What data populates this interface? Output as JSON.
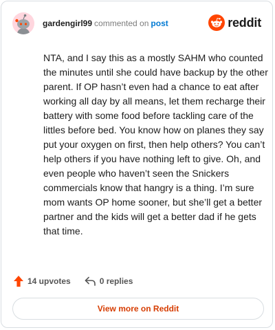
{
  "colors": {
    "accent_orange": "#ff4500",
    "link_blue": "#0079d3",
    "view_more_text": "#d63c00",
    "avatar_bg": "#ffd6de"
  },
  "header": {
    "avatar_icon": "reddit-snoo-avatar",
    "username": "gardengirl99",
    "action_text": "commented on",
    "post_link": "post",
    "brand_icon": "reddit-logo",
    "brand_name": "reddit"
  },
  "comment": {
    "text": "NTA, and I say this as a mostly SAHM who counted the minutes until she could have backup by the other parent. If OP hasn’t even had a chance to eat after working all day by all means, let them recharge their battery with some food before tackling care of the littles before bed. You know how on planes they say put your oxygen on first, then help others? You can’t help others if you have nothing left to give. Oh, and even people who haven’t seen the Snickers commercials know that hangry is a thing. I’m sure mom wants OP home sooner, but she’ll get a better partner and the kids will get a better dad if he gets that time."
  },
  "actions": {
    "upvotes_label": "14 upvotes",
    "upvote_icon": "upvote-arrow-icon",
    "replies_label": "0 replies",
    "reply_icon": "reply-arrow-icon"
  },
  "footer": {
    "view_more_label": "View more on Reddit"
  }
}
